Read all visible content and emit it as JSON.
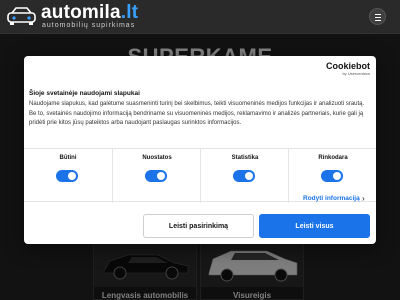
{
  "header": {
    "logo_name": "automila",
    "logo_tld": ".lt",
    "logo_tagline": "automobilių supirkimas",
    "menu_icon": "hamburger-menu-icon"
  },
  "hero": {
    "title": "SUPERKAME"
  },
  "cards": [
    {
      "label": "Lengvasis automobilis",
      "image": "black-sedan"
    },
    {
      "label": "Visureigis",
      "image": "white-suv"
    }
  ],
  "cookie_dialog": {
    "brand": "Cookiebot",
    "brand_sub": "by Usercentrics",
    "title": "Šioje svetainėje naudojami slapukai",
    "body": "Naudojame slapukus, kad galėtume suasmeninti turinį bei skelbimus, teikti visuomeninės medijos funkcijas ir analizuoti srautą. Be to, svetainės naudojimo informaciją bendriname su visuomeninės medijos, reklamavimo ir analizės partneriais, kurie gali ją pridėti prie kitos jūsų pateiktos arba naudojant paslaugas surinktos informacijos.",
    "toggles": [
      {
        "label": "Būtini",
        "on": true
      },
      {
        "label": "Nuostatos",
        "on": true
      },
      {
        "label": "Statistika",
        "on": true
      },
      {
        "label": "Rinkodara",
        "on": true
      }
    ],
    "details_link": "Rodyti informaciją",
    "allow_selection": "Leisti pasirinkimą",
    "allow_all": "Leisti visus",
    "accent_color": "#1a73e8"
  }
}
